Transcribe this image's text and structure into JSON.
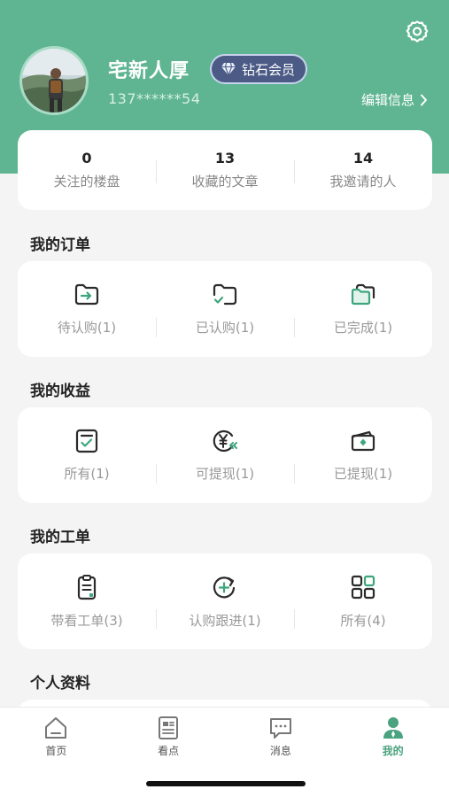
{
  "profile": {
    "name": "宅新人厚",
    "vip_label": "钻石会员",
    "phone": "137******54",
    "edit_label": "编辑信息"
  },
  "stats": [
    {
      "value": "0",
      "label": "关注的楼盘"
    },
    {
      "value": "13",
      "label": "收藏的文章"
    },
    {
      "value": "14",
      "label": "我邀请的人"
    }
  ],
  "orders": {
    "title": "我的订单",
    "items": [
      {
        "label": "待认购(1)",
        "icon": "folder-arrow-icon"
      },
      {
        "label": "已认购(1)",
        "icon": "folder-check-icon"
      },
      {
        "label": "已完成(1)",
        "icon": "folder-stack-icon"
      }
    ]
  },
  "earnings": {
    "title": "我的收益",
    "items": [
      {
        "label": "所有(1)",
        "icon": "checklist-icon"
      },
      {
        "label": "可提现(1)",
        "icon": "yen-coin-icon"
      },
      {
        "label": "已提现(1)",
        "icon": "wallet-icon"
      }
    ]
  },
  "work_orders": {
    "title": "我的工单",
    "items": [
      {
        "label": "带看工单(3)",
        "icon": "clipboard-icon"
      },
      {
        "label": "认购跟进(1)",
        "icon": "refresh-plus-icon"
      },
      {
        "label": "所有(4)",
        "icon": "grid-icon"
      }
    ]
  },
  "personal": {
    "title": "个人资料"
  },
  "tabbar": {
    "tabs": [
      {
        "label": "首页",
        "icon": "home-icon"
      },
      {
        "label": "看点",
        "icon": "article-icon"
      },
      {
        "label": "消息",
        "icon": "message-icon"
      },
      {
        "label": "我的",
        "icon": "user-icon"
      }
    ],
    "active_index": 3
  },
  "colors": {
    "brand": "#5fb592",
    "accent": "#4aa27f",
    "vip_badge": "#4b5b86"
  }
}
